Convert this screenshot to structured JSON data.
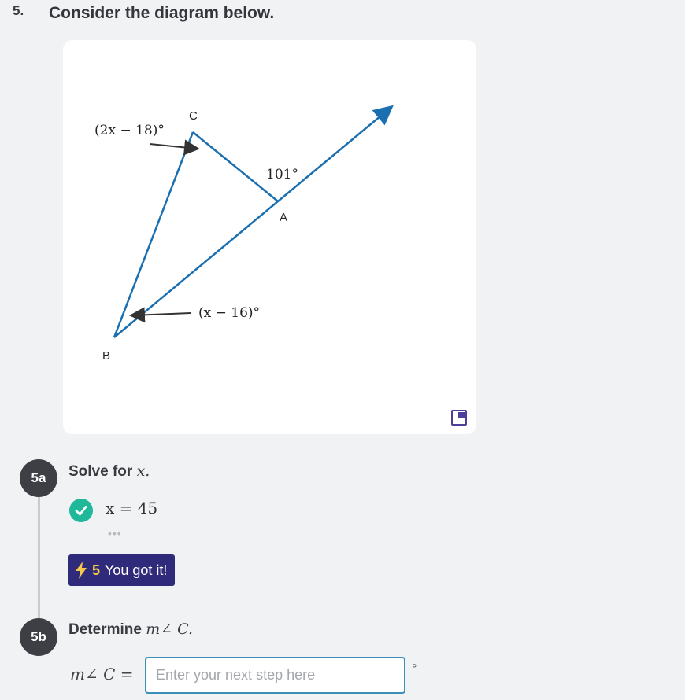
{
  "question": {
    "number": "5.",
    "title": "Consider the diagram below."
  },
  "diagram": {
    "labels": {
      "vertex_c": "C",
      "vertex_a": "A",
      "vertex_b": "B",
      "angle_c": "(2x − 18)°",
      "angle_exterior": "101°",
      "angle_b": "(x − 16)°"
    },
    "expand_icon": "expand-icon",
    "line_color": "#1a6fb0"
  },
  "step_a": {
    "badge": "5a",
    "prompt": "Solve for",
    "variable": "x.",
    "answer": "x = 45",
    "dots": "•••",
    "reward_points": "5",
    "reward_text": "You got it!"
  },
  "step_b": {
    "badge": "5b",
    "prompt": "Determine",
    "target": "m∠ C.",
    "equation_label": "m∠ C  =",
    "input_placeholder": "Enter your next step here",
    "input_value": "",
    "unit": "°"
  },
  "colors": {
    "accent": "#2f2a7a",
    "success": "#1fb89a",
    "points": "#f7c948"
  }
}
